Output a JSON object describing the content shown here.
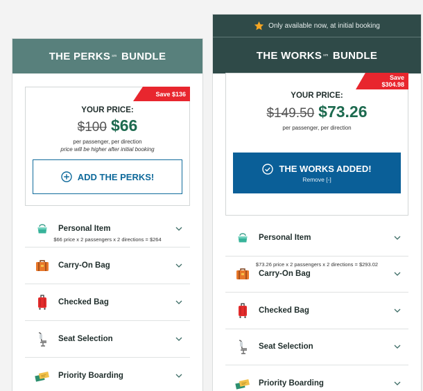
{
  "perks": {
    "title_main": "THE PERKS",
    "title_sub": "sm",
    "title_end": "BUNDLE",
    "save_badge": "Save $136",
    "price_label": "YOUR PRICE:",
    "old_price": "$100",
    "new_price": "$66",
    "per_text": "per passenger, per direction",
    "note": "price will be higher after initial booking",
    "button_label": "ADD THE PERKS!",
    "calc": "$66 price x 2 passengers x 2 directions = $264",
    "items": [
      {
        "label": "Personal Item",
        "icon": "personal-item-bag-icon"
      },
      {
        "label": "Carry-On Bag",
        "icon": "carry-on-bag-icon"
      },
      {
        "label": "Checked Bag",
        "icon": "checked-bag-icon"
      },
      {
        "label": "Seat Selection",
        "icon": "seat-icon"
      },
      {
        "label": "Priority Boarding",
        "icon": "priority-boarding-icon"
      }
    ]
  },
  "works": {
    "availability": "Only available now, at initial booking",
    "title_main": "THE WORKS",
    "title_sub": "sm",
    "title_end": "BUNDLE",
    "save_line1": "Save",
    "save_line2": "$304.98",
    "price_label": "YOUR PRICE:",
    "old_price": "$149.50",
    "new_price": "$73.26",
    "per_text": "per passenger, per direction",
    "button_label": "THE WORKS ADDED!",
    "remove_label": "Remove [-]",
    "calc": "$73.26 price x 2 passengers x 2 directions = $293.02",
    "items": [
      {
        "label": "Personal Item",
        "icon": "personal-item-bag-icon"
      },
      {
        "label": "Carry-On Bag",
        "icon": "carry-on-bag-icon"
      },
      {
        "label": "Checked Bag",
        "icon": "checked-bag-icon"
      },
      {
        "label": "Seat Selection",
        "icon": "seat-icon"
      },
      {
        "label": "Priority Boarding",
        "icon": "priority-boarding-icon"
      }
    ]
  },
  "colors": {
    "perks_header": "#58807c",
    "works_header": "#2f4a48",
    "save_red": "#e8262e",
    "price_green": "#1d6a4f",
    "action_blue": "#0a5f98"
  }
}
